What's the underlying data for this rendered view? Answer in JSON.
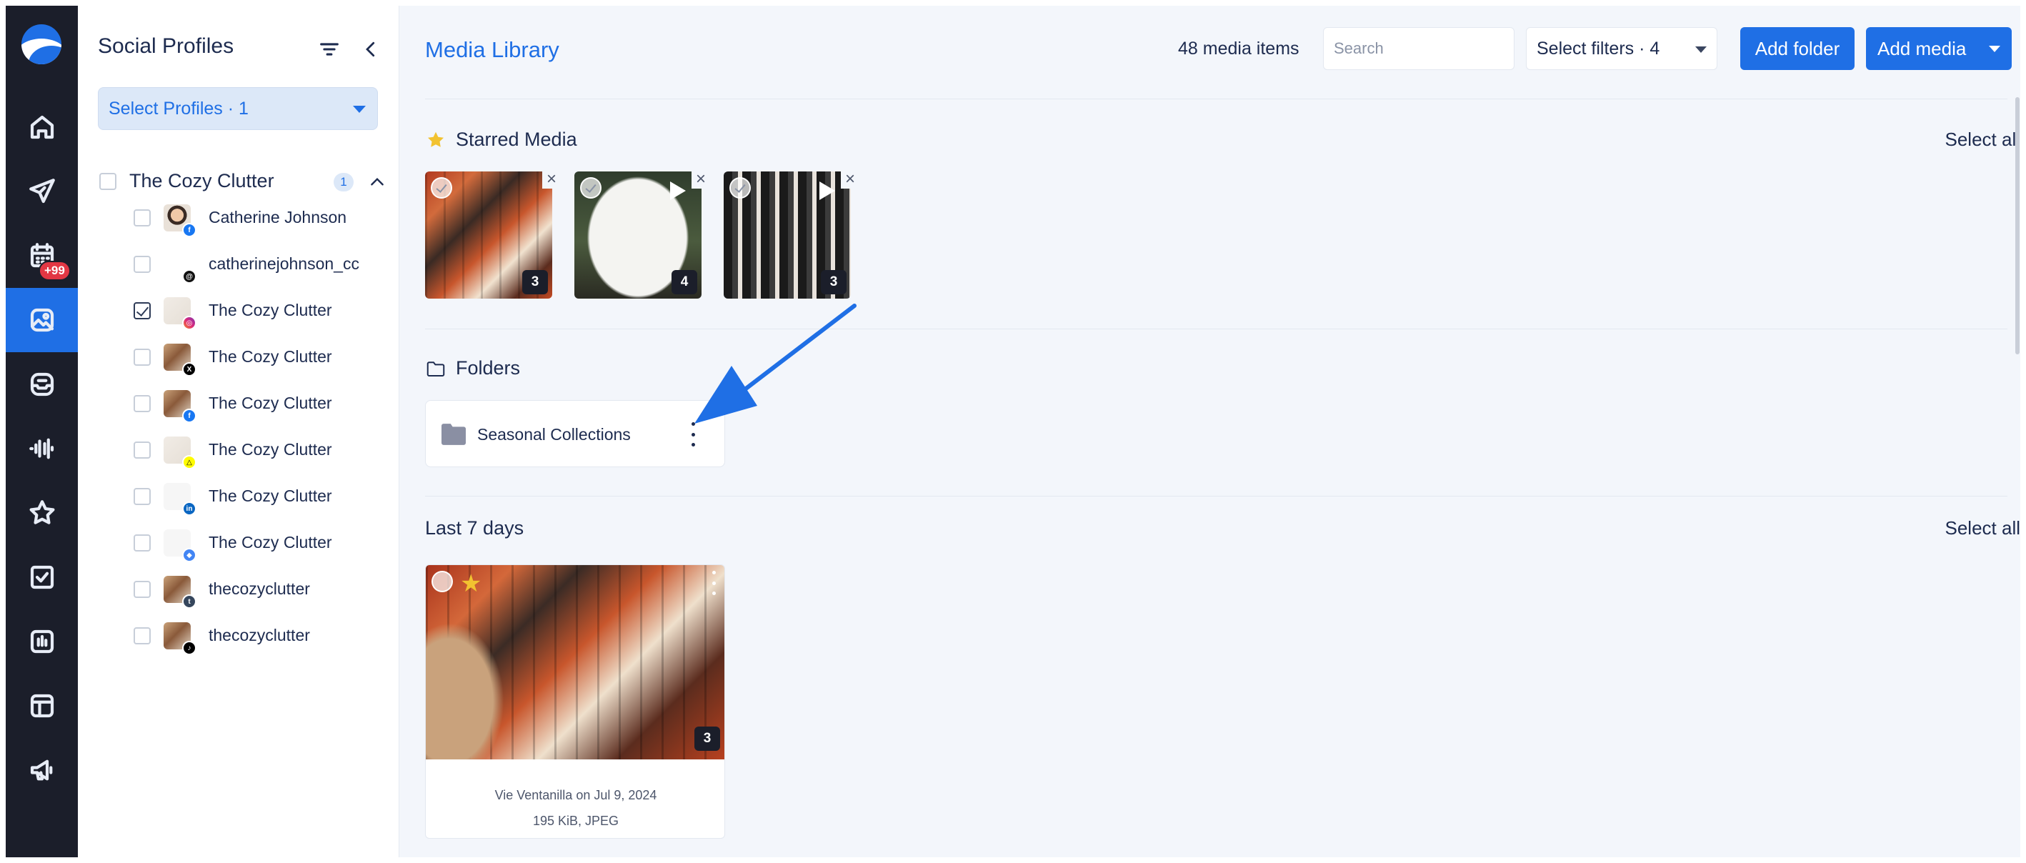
{
  "rail": {
    "items": [
      {
        "icon": "home-icon"
      },
      {
        "icon": "send-icon"
      },
      {
        "icon": "calendar-icon",
        "badge": "+99"
      },
      {
        "icon": "media-library-icon",
        "active": true
      },
      {
        "icon": "inbox-icon"
      },
      {
        "icon": "listening-icon"
      },
      {
        "icon": "star-icon"
      },
      {
        "icon": "tasks-icon"
      },
      {
        "icon": "analytics-icon"
      },
      {
        "icon": "layout-icon"
      },
      {
        "icon": "megaphone-icon"
      }
    ]
  },
  "profiles_panel": {
    "title": "Social Profiles",
    "select_button": "Select Profiles · 1",
    "group": {
      "name": "The Cozy Clutter",
      "count": "1"
    },
    "profiles": [
      {
        "name": "Catherine Johnson",
        "network": "facebook",
        "net_glyph": "f",
        "checked": false
      },
      {
        "name": "catherinejohnson_cc",
        "network": "threads",
        "net_glyph": "@",
        "checked": false
      },
      {
        "name": "The Cozy Clutter",
        "network": "instagram",
        "net_glyph": "◎",
        "checked": true
      },
      {
        "name": "The Cozy Clutter",
        "network": "x",
        "net_glyph": "X",
        "checked": false
      },
      {
        "name": "The Cozy Clutter",
        "network": "facebook",
        "net_glyph": "f",
        "checked": false
      },
      {
        "name": "The Cozy Clutter",
        "network": "snapchat",
        "net_glyph": "△",
        "checked": false
      },
      {
        "name": "The Cozy Clutter",
        "network": "linkedin",
        "net_glyph": "in",
        "checked": false
      },
      {
        "name": "The Cozy Clutter",
        "network": "google-business",
        "net_glyph": "◆",
        "checked": false
      },
      {
        "name": "thecozyclutter",
        "network": "tumblr",
        "net_glyph": "t",
        "checked": false
      },
      {
        "name": "thecozyclutter",
        "network": "tiktok",
        "net_glyph": "♪",
        "checked": false
      }
    ]
  },
  "header": {
    "title": "Media Library",
    "count": "48 media items",
    "search_placeholder": "Search",
    "filters": "Select filters · 4",
    "add_folder": "Add folder",
    "add_media": "Add media"
  },
  "starred": {
    "title": "Starred Media",
    "select_all": "Select all",
    "items": [
      {
        "count": "3",
        "video": false
      },
      {
        "count": "4",
        "video": true
      },
      {
        "count": "3",
        "video": true
      }
    ]
  },
  "folders": {
    "title": "Folders",
    "items": [
      {
        "name": "Seasonal Collections"
      }
    ]
  },
  "recent": {
    "title": "Last 7 days",
    "select_all": "Select all",
    "items": [
      {
        "count": "3",
        "caption": "Vie Ventanilla on Jul 9, 2024",
        "meta": "195 KiB, JPEG",
        "starred": true
      }
    ]
  },
  "colors": {
    "accent": "#1f6fe5",
    "rail_bg": "#1b1e2a",
    "badge": "#e23744",
    "star": "#f2c230"
  }
}
